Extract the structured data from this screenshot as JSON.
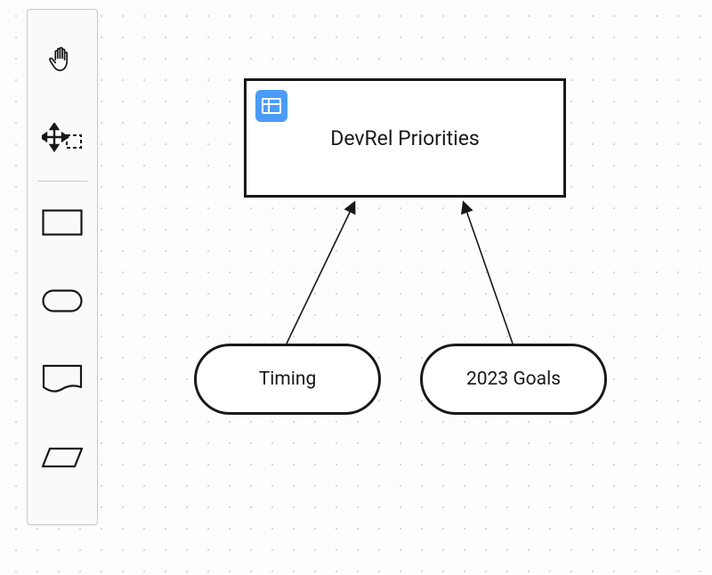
{
  "toolbar": {
    "tools": [
      {
        "name": "hand-tool",
        "icon": "hand-icon"
      },
      {
        "name": "select-tool",
        "icon": "crosshair-select-icon"
      },
      {
        "name": "rectangle-shape-tool",
        "icon": "rectangle-icon"
      },
      {
        "name": "rounded-rect-tool",
        "icon": "rounded-rect-icon"
      },
      {
        "name": "note-shape-tool",
        "icon": "note-shape-icon"
      },
      {
        "name": "parallelogram-tool",
        "icon": "parallelogram-icon"
      }
    ]
  },
  "canvas": {
    "nodes": {
      "main": {
        "label": "DevRel Priorities",
        "badge_icon": "table-grid-icon"
      },
      "left": {
        "label": "Timing"
      },
      "right": {
        "label": "2023 Goals"
      }
    }
  }
}
